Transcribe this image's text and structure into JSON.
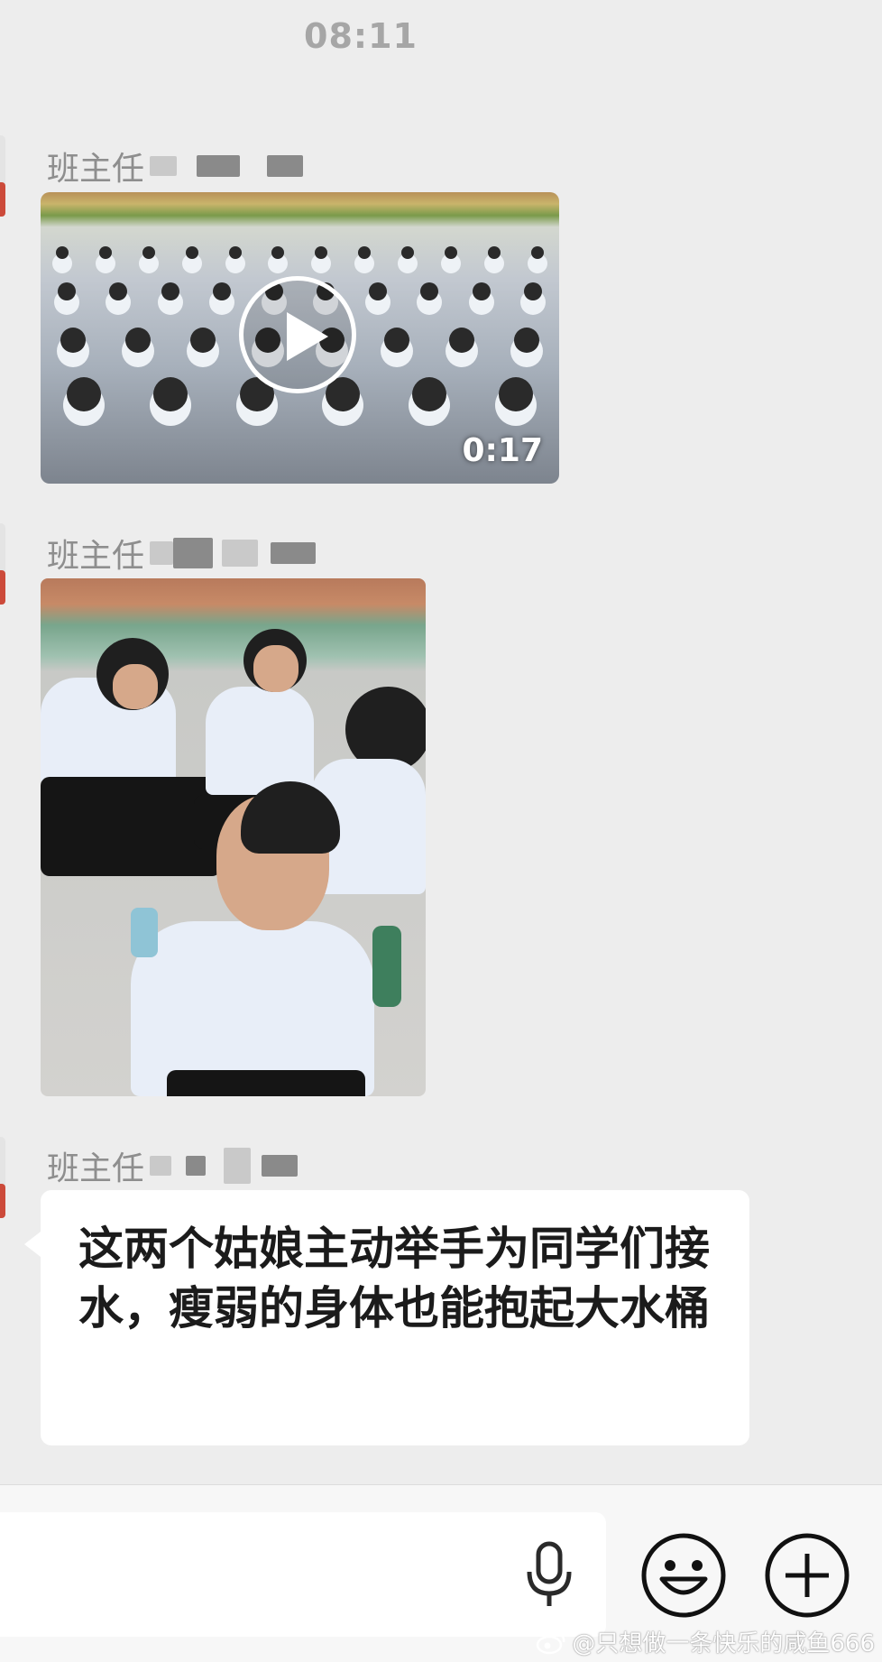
{
  "status": {
    "time": "08:11"
  },
  "messages": [
    {
      "type": "video",
      "sender": "班主任",
      "duration": "0:17"
    },
    {
      "type": "image",
      "sender": "班主任"
    },
    {
      "type": "text",
      "sender": "班主任",
      "text": "这两个姑娘主动举手为同学们接水，瘦弱的身体也能抱起大水桶"
    }
  ],
  "input_bar": {
    "mic_icon": "microphone-icon",
    "emoji_icon": "smiley-icon",
    "plus_icon": "plus-icon"
  },
  "watermark": {
    "text": "@只想做一条快乐的咸鱼666",
    "icon": "weibo-icon"
  },
  "colors": {
    "background": "#ededed",
    "bubble": "#ffffff",
    "sender_text": "#8e8e8e"
  }
}
